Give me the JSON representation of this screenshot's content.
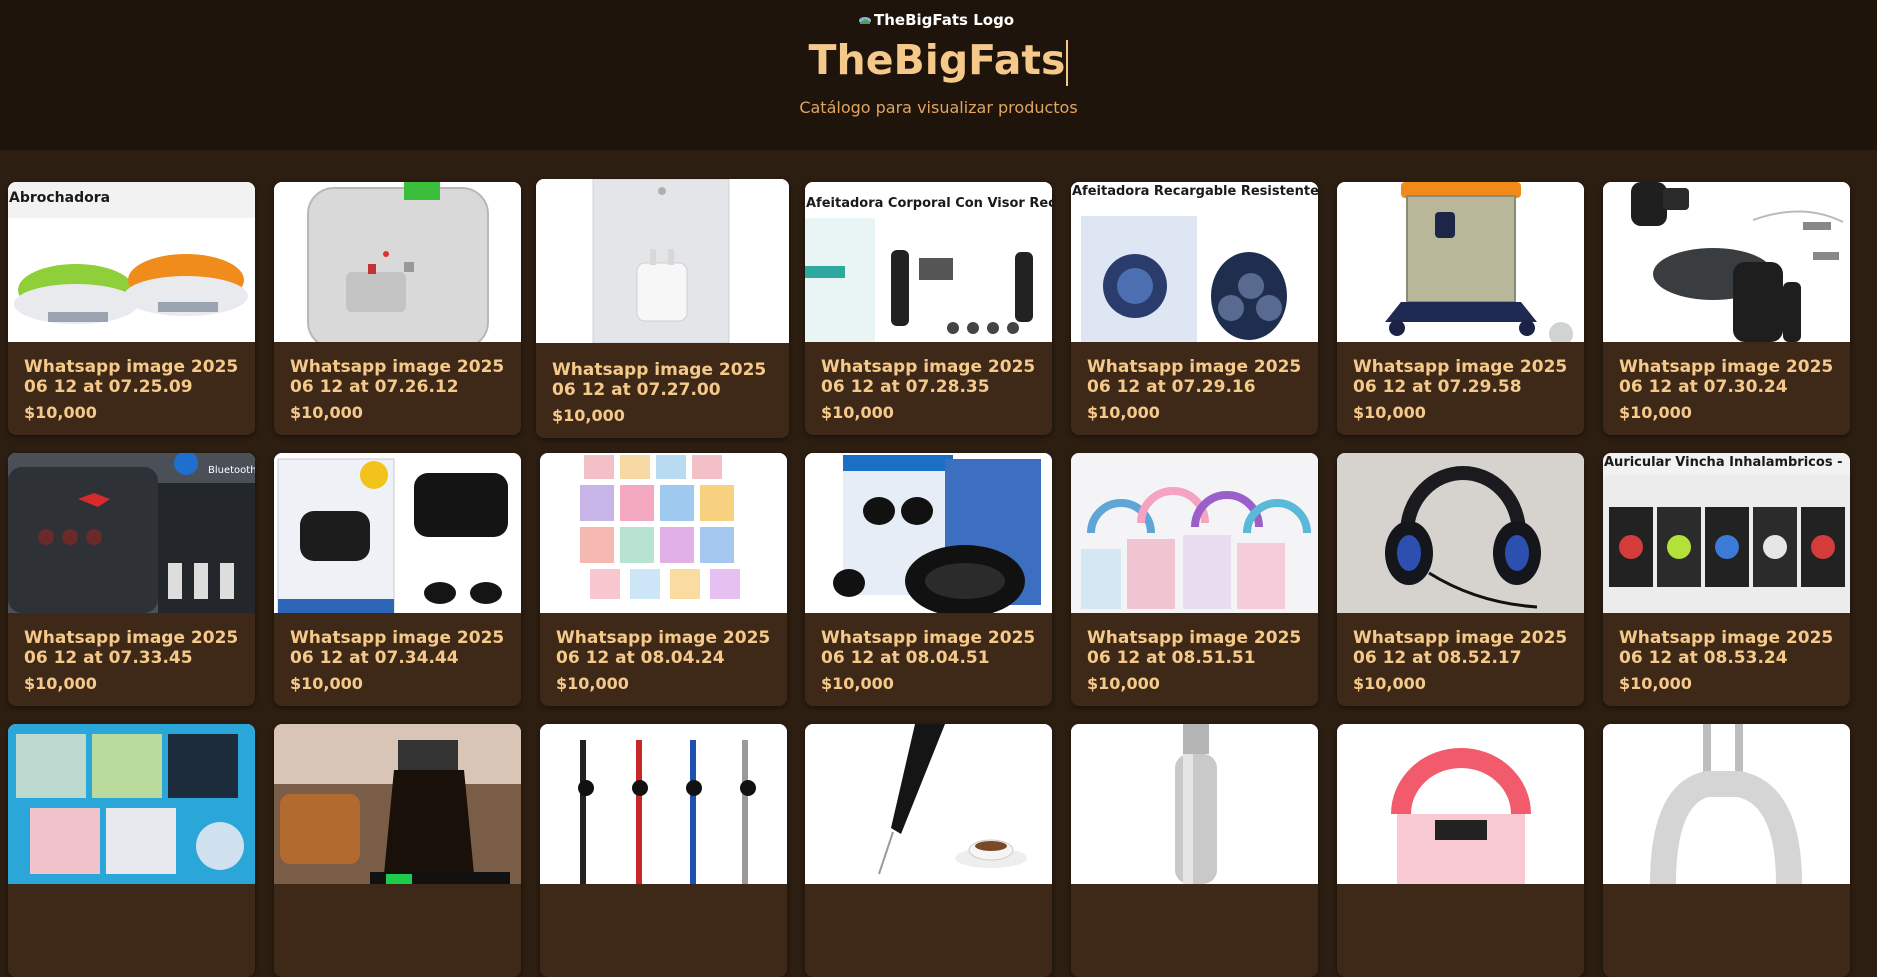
{
  "header": {
    "logo_alt": "TheBigFats Logo",
    "title": "TheBigFats",
    "subtitle": "Catálogo para visualizar productos"
  },
  "products": [
    {
      "overlay": "Abrochadora",
      "name": "Whatsapp image 2025 06 12 at 07.25.09",
      "price": "$10,000"
    },
    {
      "overlay": "",
      "name": "Whatsapp image 2025 06 12 at 07.26.12",
      "price": "$10,000"
    },
    {
      "overlay": "",
      "name": "Whatsapp image 2025 06 12 at 07.27.00",
      "price": "$10,000"
    },
    {
      "overlay": "Afeitadora Corporal Con Visor Recargable",
      "name": "Whatsapp image 2025 06 12 at 07.28.35",
      "price": "$10,000"
    },
    {
      "overlay": "Afeitadora Recargable Resistente Al Agua",
      "name": "Whatsapp image 2025 06 12 at 07.29.16",
      "price": "$10,000"
    },
    {
      "overlay": "",
      "name": "Whatsapp image 2025 06 12 at 07.29.58",
      "price": "$10,000"
    },
    {
      "overlay": "",
      "name": "Whatsapp image 2025 06 12 at 07.30.24",
      "price": "$10,000"
    },
    {
      "overlay": "",
      "name": "Whatsapp image 2025 06 12 at 07.33.45",
      "price": "$10,000"
    },
    {
      "overlay": "",
      "name": "Whatsapp image 2025 06 12 at 07.34.44",
      "price": "$10,000"
    },
    {
      "overlay": "",
      "name": "Whatsapp image 2025 06 12 at 08.04.24",
      "price": "$10,000"
    },
    {
      "overlay": "",
      "name": "Whatsapp image 2025 06 12 at 08.04.51",
      "price": "$10,000"
    },
    {
      "overlay": "",
      "name": "Whatsapp image 2025 06 12 at 08.51.51",
      "price": "$10,000"
    },
    {
      "overlay": "",
      "name": "Whatsapp image 2025 06 12 at 08.52.17",
      "price": "$10,000"
    },
    {
      "overlay": "Auricular Vincha Inhalambricos -",
      "name": "Whatsapp image 2025 06 12 at 08.53.24",
      "price": "$10,000"
    }
  ]
}
